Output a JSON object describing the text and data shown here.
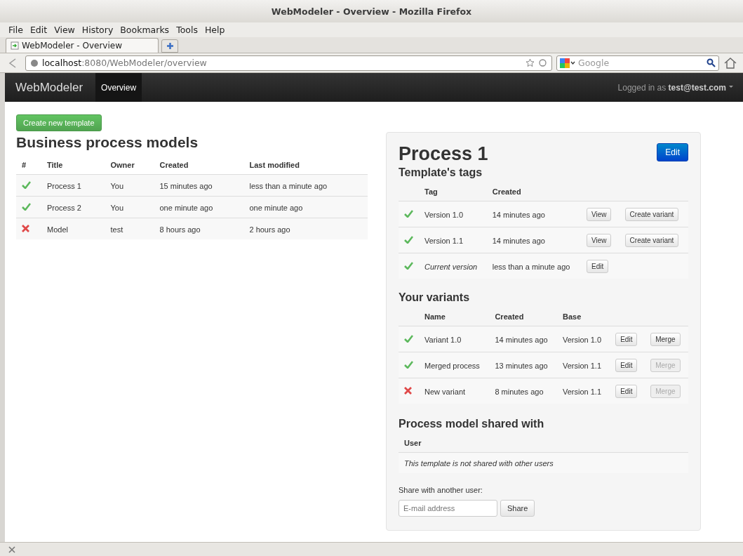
{
  "window": {
    "title": "WebModeler - Overview - Mozilla Firefox"
  },
  "menu": [
    "File",
    "Edit",
    "View",
    "History",
    "Bookmarks",
    "Tools",
    "Help"
  ],
  "tabs": [
    {
      "label": "WebModeler - Overview",
      "selected": true
    }
  ],
  "address": {
    "host": "localhost",
    "rest": ":8080/WebModeler/overview"
  },
  "search": {
    "placeholder": "Google"
  },
  "navbar": {
    "brand": "WebModeler",
    "items": [
      {
        "label": "Overview",
        "selected": true
      }
    ],
    "login_prefix": "Logged in as",
    "user": "test@test.com"
  },
  "create_button": "Create new template",
  "models": {
    "title": "Business process models",
    "columns": [
      "#",
      "Title",
      "Owner",
      "Created",
      "Last modified"
    ],
    "rows": [
      {
        "ok": true,
        "title": "Process 1",
        "owner": "You",
        "created": "15 minutes ago",
        "modified": "less than a minute ago"
      },
      {
        "ok": true,
        "title": "Process 2",
        "owner": "You",
        "created": "one minute ago",
        "modified": "one minute ago"
      },
      {
        "ok": false,
        "title": "Model",
        "owner": "test",
        "created": "8 hours ago",
        "modified": "2 hours ago"
      }
    ]
  },
  "detail": {
    "title": "Process 1",
    "edit_button": "Edit",
    "tags": {
      "title": "Template's tags",
      "columns": [
        "Tag",
        "Created"
      ],
      "rows": [
        {
          "ok": true,
          "tag": "Version 1.0",
          "italic": false,
          "created": "14 minutes ago",
          "buttons": [
            "View",
            "Create variant"
          ]
        },
        {
          "ok": true,
          "tag": "Version 1.1",
          "italic": false,
          "created": "14 minutes ago",
          "buttons": [
            "View",
            "Create variant"
          ]
        },
        {
          "ok": true,
          "tag": "Current version",
          "italic": true,
          "created": "less than a minute ago",
          "buttons": [
            "Edit"
          ]
        }
      ]
    },
    "variants": {
      "title": "Your variants",
      "columns": [
        "Name",
        "Created",
        "Base"
      ],
      "rows": [
        {
          "ok": true,
          "name": "Variant 1.0",
          "created": "14 minutes ago",
          "base": "Version 1.0",
          "edit": "Edit",
          "merge": "Merge",
          "merge_disabled": false
        },
        {
          "ok": true,
          "name": "Merged process",
          "created": "13 minutes ago",
          "base": "Version 1.1",
          "edit": "Edit",
          "merge": "Merge",
          "merge_disabled": true
        },
        {
          "ok": false,
          "name": "New variant",
          "created": "8 minutes ago",
          "base": "Version 1.1",
          "edit": "Edit",
          "merge": "Merge",
          "merge_disabled": true
        }
      ]
    },
    "shared": {
      "title": "Process model shared with",
      "column": "User",
      "empty": "This template is not shared with other users"
    },
    "share": {
      "label": "Share with another user:",
      "placeholder": "E-mail address",
      "button": "Share"
    }
  }
}
